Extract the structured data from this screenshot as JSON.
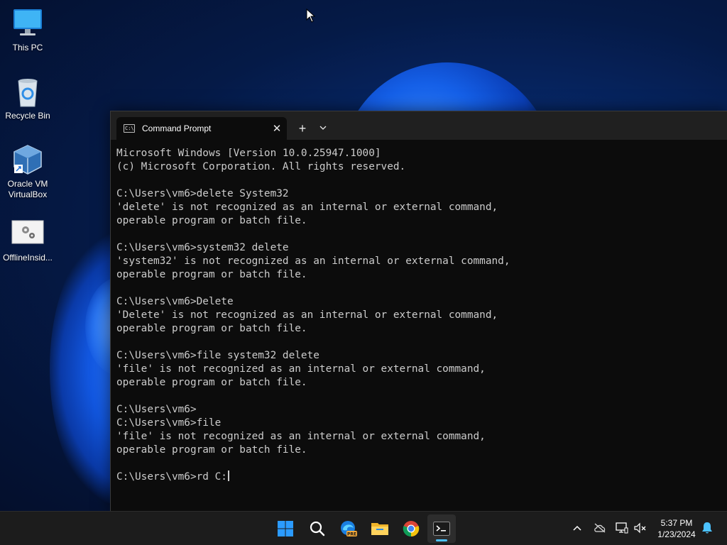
{
  "desktop": {
    "icons": [
      {
        "label": "This PC",
        "icon": "this-pc-icon"
      },
      {
        "label": "Recycle Bin",
        "icon": "recycle-bin-icon"
      },
      {
        "label": "Oracle VM\nVirtualBox",
        "icon": "virtualbox-icon"
      },
      {
        "label": "OfflineInsid...",
        "icon": "settings-file-icon"
      }
    ]
  },
  "terminal": {
    "tab_title": "Command Prompt",
    "tab_close": "✕",
    "new_tab": "+",
    "dropdown": "⌄",
    "lines": [
      "Microsoft Windows [Version 10.0.25947.1000]",
      "(c) Microsoft Corporation. All rights reserved.",
      "",
      "C:\\Users\\vm6>delete System32",
      "'delete' is not recognized as an internal or external command,",
      "operable program or batch file.",
      "",
      "C:\\Users\\vm6>system32 delete",
      "'system32' is not recognized as an internal or external command,",
      "operable program or batch file.",
      "",
      "C:\\Users\\vm6>Delete",
      "'Delete' is not recognized as an internal or external command,",
      "operable program or batch file.",
      "",
      "C:\\Users\\vm6>file system32 delete",
      "'file' is not recognized as an internal or external command,",
      "operable program or batch file.",
      "",
      "C:\\Users\\vm6>",
      "C:\\Users\\vm6>file",
      "'file' is not recognized as an internal or external command,",
      "operable program or batch file.",
      ""
    ],
    "current_input": "C:\\Users\\vm6>rd C:"
  },
  "taskbar": {
    "apps": [
      {
        "name": "start-button",
        "icon": "windows-logo-icon"
      },
      {
        "name": "search-button",
        "icon": "search-icon"
      },
      {
        "name": "edge-beta-button",
        "icon": "edge-pre-icon",
        "badge": "PRE"
      },
      {
        "name": "file-explorer-button",
        "icon": "folder-icon"
      },
      {
        "name": "chrome-button",
        "icon": "chrome-icon"
      },
      {
        "name": "terminal-button",
        "icon": "terminal-icon",
        "active": true
      }
    ],
    "tray": {
      "chevron": "^",
      "time": "5:37 PM",
      "date": "1/23/2024"
    }
  },
  "colors": {
    "accent": "#4cc2ff",
    "console_fg": "#cccccc",
    "console_bg": "#0c0c0c"
  }
}
